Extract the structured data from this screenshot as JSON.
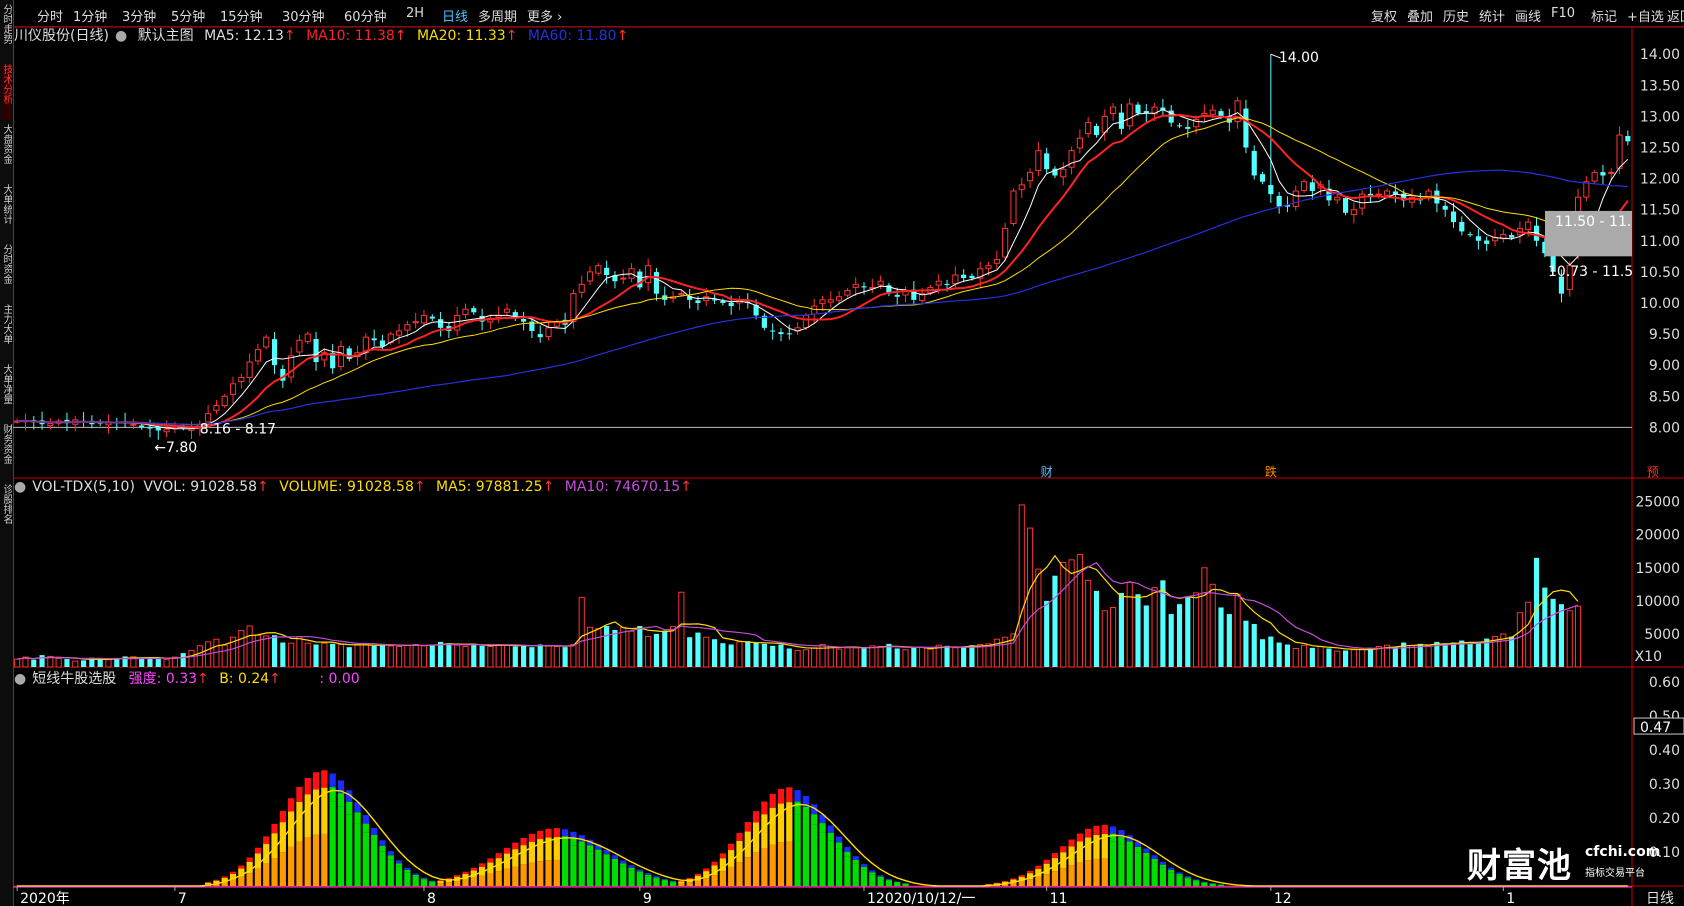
{
  "left_tabs": [
    {
      "label": "分时走势",
      "active": false
    },
    {
      "label": "技术分析",
      "active": true
    },
    {
      "label": "大盘资金",
      "active": false
    },
    {
      "label": "大单统计",
      "active": false
    },
    {
      "label": "分时资金",
      "active": false
    },
    {
      "label": "主力大单",
      "active": false
    },
    {
      "label": "大单净量",
      "active": false
    },
    {
      "label": "财务资金",
      "active": false
    },
    {
      "label": "诊股排名",
      "active": false
    }
  ],
  "toolbar": {
    "periods": [
      {
        "label": "分时",
        "active": false
      },
      {
        "label": "1分钟",
        "active": false
      },
      {
        "label": "3分钟",
        "active": false
      },
      {
        "label": "5分钟",
        "active": false
      },
      {
        "label": "15分钟",
        "active": false
      },
      {
        "label": "30分钟",
        "active": false
      },
      {
        "label": "60分钟",
        "active": false
      },
      {
        "label": "2H",
        "active": false
      },
      {
        "label": "日线",
        "active": true
      },
      {
        "label": "多周期",
        "active": false
      },
      {
        "label": "更多 ›",
        "active": false
      }
    ],
    "right_buttons": [
      "复权",
      "叠加",
      "历史",
      "统计",
      "画线",
      "F10",
      "标记",
      "+自选",
      "返回"
    ]
  },
  "main_legend": {
    "stock": "川仪股份(日线)",
    "template": "默认主图",
    "ma5": "MA5: 12.13",
    "ma10": "MA10: 11.38",
    "ma20": "MA20: 11.33",
    "ma60": "MA60: 11.80",
    "colors": {
      "ma5": "#ffffff",
      "ma10": "#ff2222",
      "ma20": "#ffdd00",
      "ma60": "#2233dd"
    }
  },
  "vol_legend": {
    "name": "VOL-TDX(5,10)",
    "vvol": "VVOL: 91028.58",
    "volume": "VOLUME: 91028.58",
    "ma5": "MA5: 97881.25",
    "ma10": "MA10: 74670.15"
  },
  "ind_legend": {
    "name": "短线牛股选股",
    "strength": "强度: 0.33",
    "b": "B: 0.24",
    "c": ": 0.00"
  },
  "annotations": {
    "high": "14.00",
    "low": "7.80",
    "range1": "8.16 - 8.17",
    "range2": "11.50 - 11.",
    "range3": "10.73 - 11.5",
    "events": [
      "财",
      "跌",
      "预"
    ],
    "x10": "X10",
    "current_ind": "0.47",
    "period_label": "日线"
  },
  "watermark": {
    "brand": "财富池",
    "site": "cfchi.com",
    "slogan": "指标交易平台"
  },
  "chart_data": [
    {
      "type": "candlestick",
      "title": "川仪股份(日线)",
      "ylim": [
        7.7,
        14.1
      ],
      "yticks": [
        14.0,
        13.5,
        13.0,
        12.5,
        12.0,
        11.5,
        11.0,
        10.5,
        10.0,
        9.5,
        9.0,
        8.5,
        8.0
      ],
      "x_labels": [
        {
          "i": 0,
          "label": "2020年"
        },
        {
          "i": 19,
          "label": "7"
        },
        {
          "i": 49,
          "label": "8"
        },
        {
          "i": 75,
          "label": "9"
        },
        {
          "i": 102,
          "label": "12020/10/12/一"
        },
        {
          "i": 124,
          "label": "11"
        },
        {
          "i": 151,
          "label": "12"
        },
        {
          "i": 179,
          "label": "1"
        }
      ],
      "closes": [
        8.1,
        8.11,
        8.08,
        8.05,
        8.06,
        8.1,
        8.08,
        8.12,
        8.1,
        8.05,
        8.06,
        8.09,
        8.07,
        8.08,
        8.05,
        8.0,
        7.98,
        7.95,
        7.97,
        8.0,
        7.99,
        7.98,
        8.05,
        8.22,
        8.35,
        8.5,
        8.7,
        8.8,
        9.05,
        9.25,
        9.45,
        9.0,
        8.75,
        9.15,
        9.4,
        9.5,
        9.05,
        9.2,
        8.95,
        9.3,
        9.1,
        9.2,
        9.45,
        9.4,
        9.3,
        9.5,
        9.55,
        9.65,
        9.7,
        9.8,
        9.75,
        9.6,
        9.55,
        9.8,
        9.9,
        9.85,
        9.7,
        9.75,
        9.8,
        9.9,
        9.75,
        9.7,
        9.55,
        9.45,
        9.6,
        9.7,
        9.65,
        10.15,
        10.3,
        10.5,
        10.6,
        10.45,
        10.35,
        10.4,
        10.55,
        10.25,
        10.6,
        10.15,
        10.05,
        10.1,
        10.15,
        10.05,
        10.0,
        10.1,
        10.05,
        10.0,
        9.95,
        10.05,
        10.0,
        9.8,
        9.6,
        9.55,
        9.5,
        9.5,
        9.6,
        9.8,
        9.95,
        10.05,
        10.05,
        10.1,
        10.2,
        10.3,
        10.25,
        10.25,
        10.35,
        10.15,
        10.1,
        10.2,
        10.05,
        10.15,
        10.25,
        10.35,
        10.3,
        10.45,
        10.4,
        10.4,
        10.55,
        10.6,
        10.7,
        11.2,
        11.8,
        11.9,
        12.1,
        12.45,
        12.15,
        12.05,
        12.15,
        12.45,
        12.65,
        12.9,
        12.7,
        13.0,
        13.15,
        12.8,
        13.2,
        13.05,
        13.05,
        13.15,
        13.1,
        12.9,
        12.85,
        12.8,
        12.95,
        13.05,
        13.1,
        13.0,
        12.9,
        13.25,
        12.5,
        12.05,
        11.95,
        11.75,
        11.55,
        11.55,
        11.8,
        11.95,
        11.8,
        11.9,
        11.65,
        11.7,
        11.45,
        11.5,
        11.75,
        11.7,
        11.75,
        11.8,
        11.75,
        11.65,
        11.7,
        11.65,
        11.8,
        11.6,
        11.5,
        11.3,
        11.15,
        11.1,
        11.0,
        10.95,
        11.05,
        11.1,
        11.05,
        11.2,
        11.3,
        11.0,
        10.8,
        10.5,
        10.15,
        10.6,
        11.7,
        11.95,
        12.1,
        12.05,
        12.1,
        12.7,
        12.6
      ],
      "series": [
        {
          "name": "MA5",
          "color": "#ffffff"
        },
        {
          "name": "MA10",
          "color": "#ff2222"
        },
        {
          "name": "MA20",
          "color": "#ffdd00"
        },
        {
          "name": "MA60",
          "color": "#2233dd"
        }
      ]
    },
    {
      "type": "bar",
      "title": "VOL-TDX(5,10)",
      "ylim": [
        0,
        26000
      ],
      "yticks": [
        25000,
        20000,
        15000,
        10000,
        5000
      ],
      "values": [
        1200,
        1500,
        1100,
        1800,
        1600,
        1300,
        1200,
        900,
        1000,
        1400,
        1300,
        1100,
        1250,
        1600,
        1550,
        1450,
        1300,
        1200,
        1150,
        1500,
        2100,
        2500,
        3200,
        3800,
        4200,
        3300,
        4500,
        5500,
        6200,
        4800,
        4700,
        4800,
        3700,
        3600,
        4600,
        3600,
        3400,
        3600,
        3500,
        3400,
        3000,
        3300,
        3500,
        3200,
        3500,
        3200,
        3100,
        3300,
        3400,
        3200,
        3400,
        3800,
        3600,
        3300,
        3100,
        3500,
        3200,
        3100,
        3400,
        3300,
        3100,
        3300,
        3000,
        3400,
        3200,
        3100,
        3000,
        3400,
        10500,
        6000,
        5800,
        6200,
        5600,
        6000,
        5400,
        6200,
        4600,
        5000,
        5500,
        6100,
        11300,
        4500,
        5200,
        4500,
        4200,
        3600,
        3400,
        3800,
        3900,
        3700,
        3500,
        3200,
        3400,
        2800,
        2500,
        2600,
        2900,
        3400,
        3100,
        2700,
        2900,
        2900,
        3000,
        3200,
        3100,
        3500,
        2800,
        2600,
        2900,
        3000,
        2700,
        3300,
        3200,
        2900,
        3100,
        3300,
        3400,
        3500,
        4200,
        4500,
        5000,
        24500,
        21000,
        14800,
        10000,
        13800,
        15800,
        16200,
        17000,
        13100,
        11500,
        8500,
        9000,
        11200,
        12800,
        11000,
        9300,
        12000,
        13100,
        8000,
        9500,
        10500,
        11200,
        15000,
        12500,
        9000,
        8000,
        11000,
        7000,
        6500,
        4200,
        4600,
        3700,
        3400,
        2800,
        3300,
        2900,
        3100,
        2800,
        2400,
        2500,
        2600,
        2800,
        2900,
        3100,
        3300,
        3000,
        3700,
        3200,
        3500,
        3200,
        3800,
        3600,
        3700,
        4000,
        3500,
        3800,
        4300,
        4600,
        5000,
        4600,
        8200,
        9800,
        16500,
        12000,
        10300,
        9500,
        8500,
        9200
      ],
      "ma_lines": [
        {
          "name": "MA5",
          "color": "#ffdd00"
        },
        {
          "name": "MA10",
          "color": "#c44ed8"
        }
      ]
    },
    {
      "type": "bar",
      "title": "短线牛股选股",
      "ylim": [
        0,
        0.62
      ],
      "yticks": [
        0.6,
        0.5,
        0.4,
        0.3,
        0.2,
        0.1
      ],
      "series": [
        {
          "name": "强度",
          "color": "#ff44ff"
        },
        {
          "name": "B",
          "color": "#ffdd00"
        }
      ],
      "bumps": [
        {
          "center": 37,
          "width": 9,
          "peak": 0.34
        },
        {
          "center": 65,
          "width": 11,
          "peak": 0.17
        },
        {
          "center": 93,
          "width": 9,
          "peak": 0.29
        },
        {
          "center": 131,
          "width": 9,
          "peak": 0.18
        },
        {
          "center": 200,
          "width": 3,
          "peak": 0.36
        }
      ]
    }
  ]
}
